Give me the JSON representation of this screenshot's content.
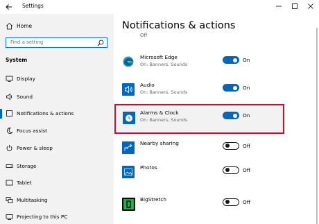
{
  "window": {
    "title": "Settings",
    "back_icon": "back-arrow-icon",
    "controls": [
      "minimize-icon",
      "maximize-icon",
      "close-icon"
    ]
  },
  "sidebar": {
    "home_label": "Home",
    "search_placeholder": "Find a setting",
    "section_heading": "System",
    "items": [
      {
        "label": "Display",
        "icon": "display-icon"
      },
      {
        "label": "Sound",
        "icon": "speaker-icon"
      },
      {
        "label": "Notifications & actions",
        "icon": "notifications-icon",
        "selected": true
      },
      {
        "label": "Focus assist",
        "icon": "moon-icon"
      },
      {
        "label": "Power & sleep",
        "icon": "power-icon"
      },
      {
        "label": "Storage",
        "icon": "storage-icon"
      },
      {
        "label": "Tablet",
        "icon": "tablet-icon"
      },
      {
        "label": "Multitasking",
        "icon": "multitasking-icon"
      },
      {
        "label": "Projecting to this PC",
        "icon": "projector-icon"
      }
    ]
  },
  "main": {
    "title": "Notifications & actions",
    "partial_row_text": "Off",
    "apps": [
      {
        "name": "Microsoft Edge",
        "sub": "On: Banners, Sounds",
        "state": "On",
        "on": true,
        "icon": "edge-icon"
      },
      {
        "name": "Audio",
        "sub": "On: Banners, Sounds",
        "state": "On",
        "on": true,
        "icon": "audio-icon"
      },
      {
        "name": "Alarms & Clock",
        "sub": "On: Banners, Sounds",
        "state": "On",
        "on": true,
        "icon": "alarm-clock-icon",
        "highlighted": true
      },
      {
        "name": "Nearby sharing",
        "sub": "",
        "state": "Off",
        "on": false,
        "icon": "share-icon"
      },
      {
        "name": "Photos",
        "sub": "",
        "state": "Off",
        "on": false,
        "icon": "photos-icon"
      },
      {
        "name": "BigStretch",
        "sub": "",
        "state": "Off",
        "on": false,
        "icon": "bigstretch-icon"
      }
    ]
  },
  "colors": {
    "accent": "#0067c0",
    "highlight_border": "#c8102e",
    "sidebar_bg": "#f2f2f2"
  }
}
